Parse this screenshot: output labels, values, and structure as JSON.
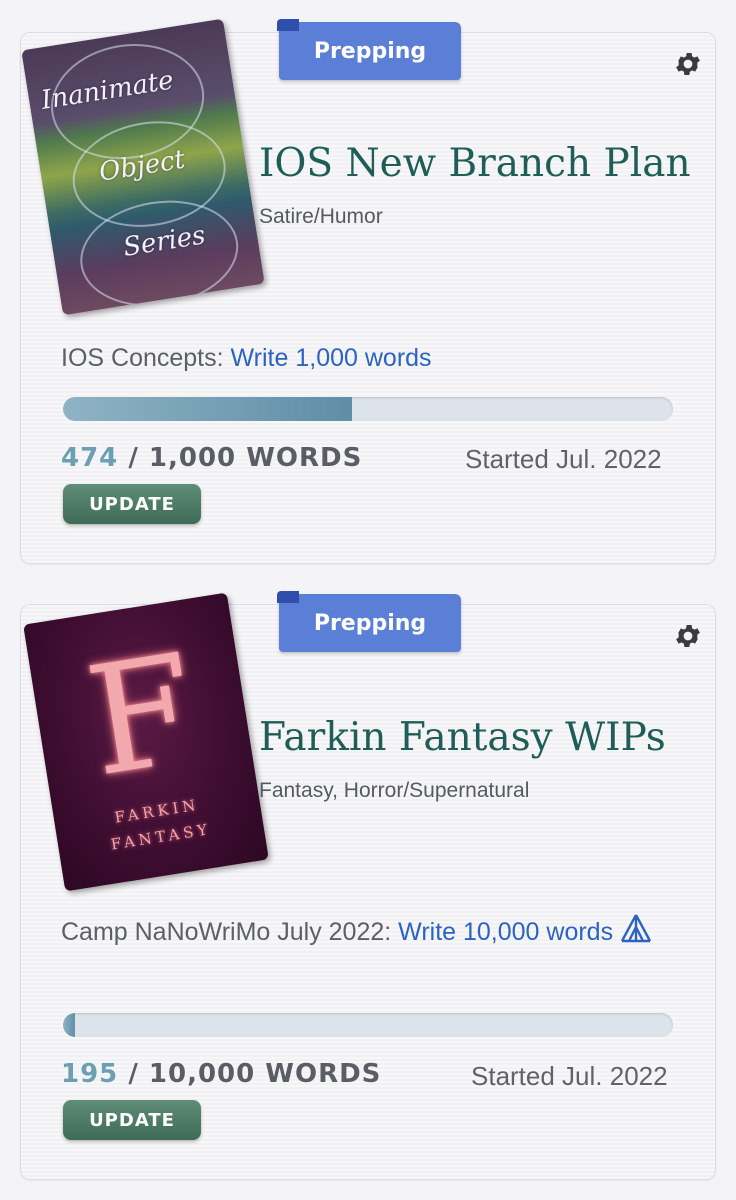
{
  "projects": [
    {
      "status": "Prepping",
      "title": "IOS New Branch Plan",
      "genre": "Satire/Humor",
      "cover_text": [
        "Inanimate",
        "Object",
        "Series"
      ],
      "goal_label": "IOS Concepts:",
      "goal_link": "Write 1,000 words",
      "progress_fraction": 0.474,
      "current": "474",
      "separator": "/",
      "target": "1,000 WORDS",
      "update_label": "UPDATE",
      "started": "Started Jul. 2022"
    },
    {
      "status": "Prepping",
      "title": "Farkin Fantasy WIPs",
      "genre": "Fantasy, Horror/Supernatural",
      "cover_text": [
        "F",
        "FARKIN",
        "FANTASY"
      ],
      "goal_label": "Camp NaNoWriMo July 2022:",
      "goal_link": "Write 10,000 words",
      "progress_fraction": 0.0195,
      "current": "195",
      "separator": "/",
      "target": "10,000 WORDS",
      "update_label": "UPDATE",
      "started": "Started Jul. 2022"
    }
  ],
  "icons": {
    "settings": "gear-icon",
    "camp": "tent-icon"
  },
  "colors": {
    "tab": "#5b7ed6",
    "title": "#1f5e57",
    "link": "#2c63c2",
    "progress": "#6c9fb2",
    "update_button": "#4a7862"
  }
}
